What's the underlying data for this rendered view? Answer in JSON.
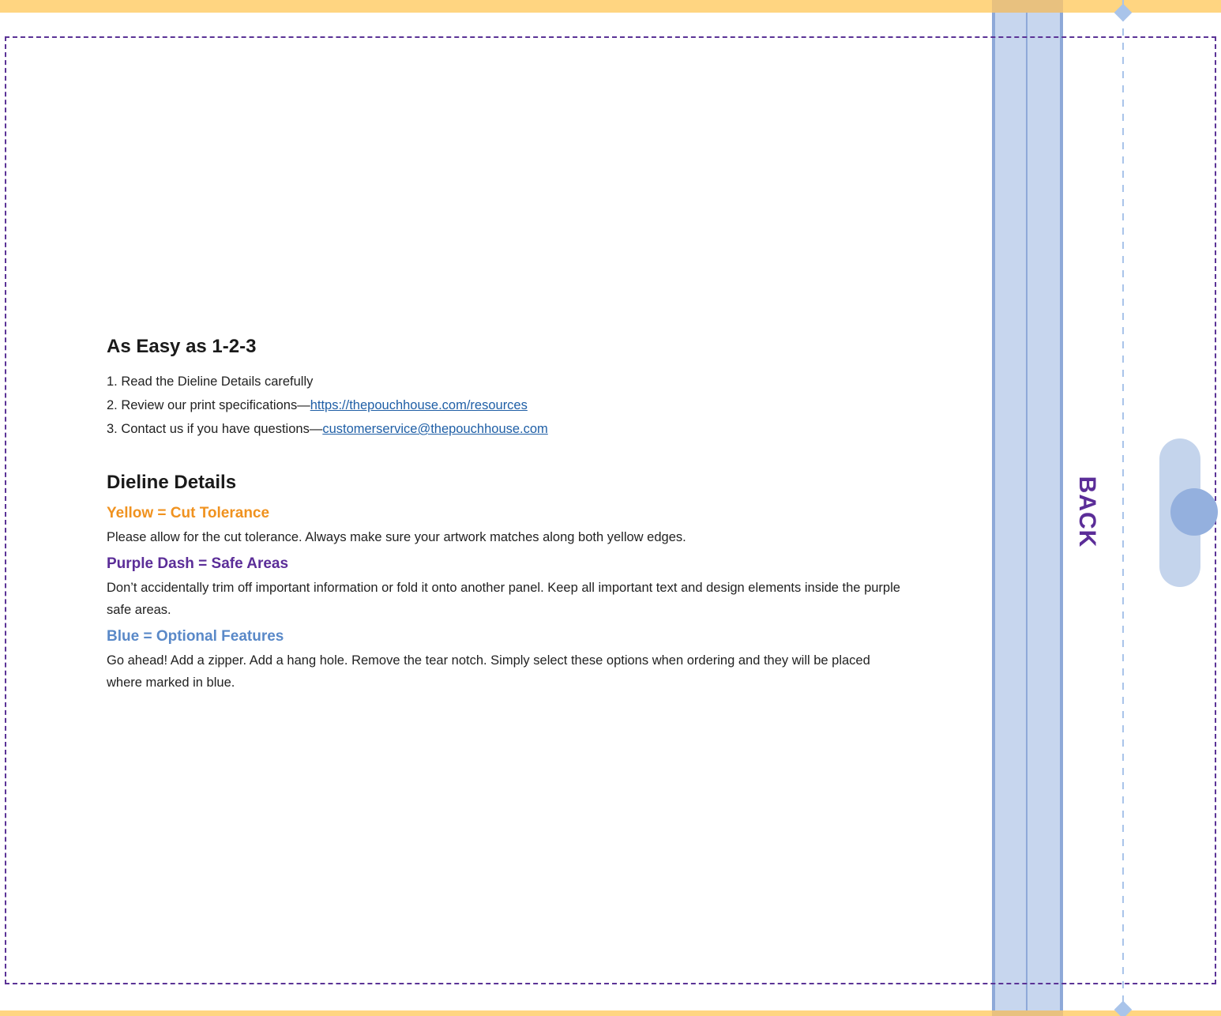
{
  "colors": {
    "cut_tolerance": "#ffd581",
    "safe_area": "#5b3396",
    "optional_features": "#c7d6ee",
    "heading_yellow": "#f0921f",
    "heading_purple": "#5b2d98",
    "heading_blue": "#5a89c8",
    "link": "#1f5fa6"
  },
  "panel_label": "BACK",
  "easy": {
    "title": "As Easy as 1-2-3",
    "step1": "1. Read the Dieline Details carefully",
    "step2_prefix": "2. Review our print specifications—",
    "step2_link": "https://thepouchhouse.com/resources ",
    "step3_prefix": "3. Contact us if you have questions—",
    "step3_link": "customerservice@thepouchhouse.com"
  },
  "dieline": {
    "title": "Dieline Details",
    "yellow_heading": "Yellow = Cut Tolerance",
    "yellow_text": "Please allow for the cut tolerance. Always make sure your artwork matches along both yellow edges.",
    "purple_heading": "Purple Dash = Safe Areas",
    "purple_text": "Don’t accidentally trim off important information or fold it onto another panel. Keep all important text and design elements inside the purple safe areas.",
    "blue_heading": "Blue = Optional Features",
    "blue_text": "Go ahead! Add a zipper. Add a hang hole. Remove the tear notch. Simply select these options when ordering and they will be placed where marked in blue."
  }
}
